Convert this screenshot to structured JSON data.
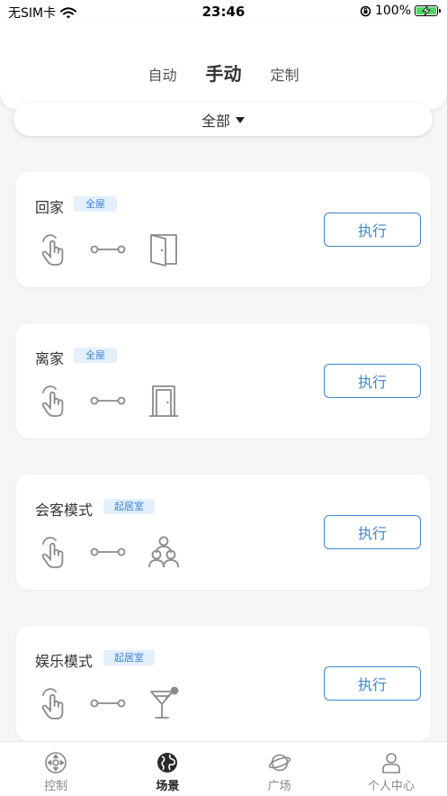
{
  "status_bar": {
    "carrier": "无SIM卡",
    "time": "23:46",
    "battery_percent_label": "100%",
    "battery_level": 1.0,
    "icons": [
      "wifi-icon",
      "orientation-lock-icon",
      "battery-charging-icon"
    ]
  },
  "header": {
    "tabs": [
      {
        "label": "自动",
        "active": false
      },
      {
        "label": "手动",
        "active": true
      },
      {
        "label": "定制",
        "active": false
      }
    ]
  },
  "filter": {
    "label": "全部",
    "icon": "caret-down-icon"
  },
  "scenes": [
    {
      "title": "回家",
      "tag": "全屋",
      "scene_icon": "door-open-icon",
      "action_label": "执行"
    },
    {
      "title": "离家",
      "tag": "全屋",
      "scene_icon": "door-closed-icon",
      "action_label": "执行"
    },
    {
      "title": "会客模式",
      "tag": "起居室",
      "scene_icon": "people-group-icon",
      "action_label": "执行"
    },
    {
      "title": "娱乐模式",
      "tag": "起居室",
      "scene_icon": "cocktail-icon",
      "action_label": "执行"
    }
  ],
  "bottom_nav": {
    "items": [
      {
        "label": "控制",
        "icon": "control-pad-icon",
        "active": false
      },
      {
        "label": "场景",
        "icon": "globe-icon",
        "active": true
      },
      {
        "label": "广场",
        "icon": "planet-icon",
        "active": false
      },
      {
        "label": "个人中心",
        "icon": "person-icon",
        "active": false
      }
    ]
  },
  "colors": {
    "accent": "#3d86d6",
    "badge_bg": "#e4effc",
    "background": "#f6f6f6",
    "icon_gray": "#8a8a8a"
  }
}
